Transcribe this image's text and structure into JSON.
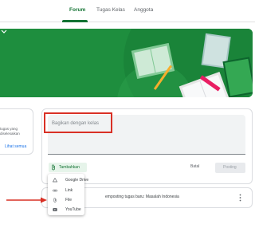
{
  "tabs": [
    {
      "label": "Forum",
      "active": true
    },
    {
      "label": "Tugas Kelas",
      "active": false
    },
    {
      "label": "Anggota",
      "active": false
    }
  ],
  "left_panel": {
    "line1": "tugas yang",
    "line2": "diselesaikan",
    "link": "Lihat semua"
  },
  "compose": {
    "placeholder": "Bagikan dengan kelas",
    "attach_label": "Tambahkan",
    "cancel_label": "Batal",
    "post_label": "Posting"
  },
  "attach_menu": {
    "items": [
      {
        "label": "Google Drive",
        "icon": "google-drive-icon"
      },
      {
        "label": "Link",
        "icon": "link-icon"
      },
      {
        "label": "File",
        "icon": "paperclip-icon"
      },
      {
        "label": "YouTube",
        "icon": "youtube-icon"
      }
    ]
  },
  "stream": {
    "post_text": "emposting tugas baru: Masalah Indonesia"
  },
  "colors": {
    "accent": "#137333",
    "banner": "#1e8e3e",
    "annotation": "#d93025"
  }
}
